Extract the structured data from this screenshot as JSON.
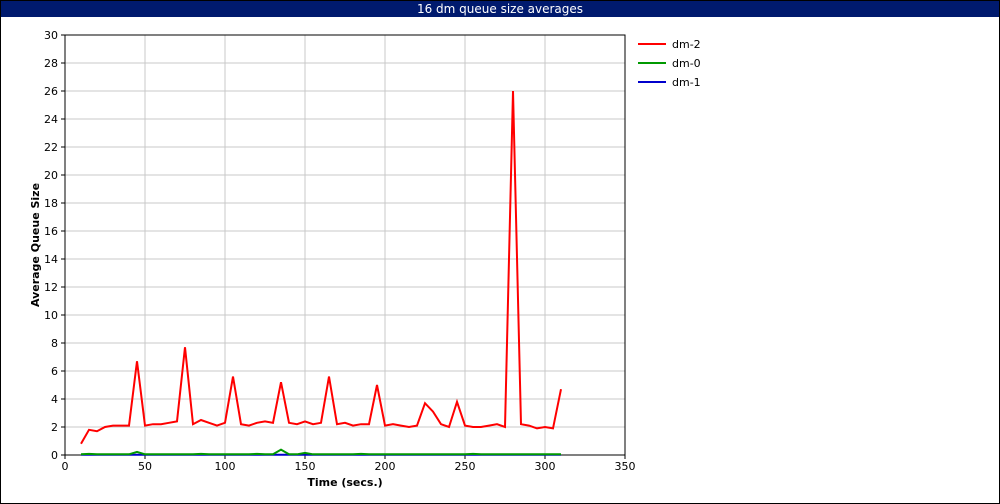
{
  "chart_data": {
    "type": "line",
    "title": "16 dm queue size averages",
    "xlabel": "Time (secs.)",
    "ylabel": "Average Queue Size",
    "xlim": [
      0,
      350
    ],
    "ylim": [
      0,
      30
    ],
    "xticks": [
      0,
      50,
      100,
      150,
      200,
      250,
      300,
      350
    ],
    "yticks": [
      0,
      2,
      4,
      6,
      8,
      10,
      12,
      14,
      16,
      18,
      20,
      22,
      24,
      26,
      28,
      30
    ],
    "grid": true,
    "legend_position": "top-right, outside plot",
    "x": [
      10,
      15,
      20,
      25,
      30,
      35,
      40,
      45,
      50,
      55,
      60,
      65,
      70,
      75,
      80,
      85,
      90,
      95,
      100,
      105,
      110,
      115,
      120,
      125,
      130,
      135,
      140,
      145,
      150,
      155,
      160,
      165,
      170,
      175,
      180,
      185,
      190,
      195,
      200,
      205,
      210,
      215,
      220,
      225,
      230,
      235,
      240,
      245,
      250,
      255,
      260,
      265,
      270,
      275,
      280,
      285,
      290,
      295,
      300,
      305,
      310
    ],
    "series": [
      {
        "name": "dm-2",
        "color": "#ff0000",
        "values": [
          0.8,
          1.8,
          1.7,
          2.0,
          2.1,
          2.1,
          2.1,
          6.7,
          2.1,
          2.2,
          2.2,
          2.3,
          2.4,
          7.7,
          2.2,
          2.5,
          2.3,
          2.1,
          2.3,
          5.6,
          2.2,
          2.1,
          2.3,
          2.4,
          2.3,
          5.2,
          2.3,
          2.2,
          2.4,
          2.2,
          2.3,
          5.6,
          2.2,
          2.3,
          2.1,
          2.2,
          2.2,
          5.0,
          2.1,
          2.2,
          2.1,
          2.0,
          2.1,
          3.7,
          3.1,
          2.2,
          2.0,
          3.8,
          2.1,
          2.0,
          2.0,
          2.1,
          2.2,
          2.0,
          26.0,
          2.2,
          2.1,
          1.9,
          2.0,
          1.9,
          4.7
        ]
      },
      {
        "name": "dm-0",
        "color": "#009900",
        "values": [
          0.05,
          0.08,
          0.05,
          0.05,
          0.05,
          0.05,
          0.05,
          0.22,
          0.05,
          0.05,
          0.05,
          0.05,
          0.05,
          0.05,
          0.05,
          0.08,
          0.05,
          0.05,
          0.05,
          0.05,
          0.05,
          0.05,
          0.08,
          0.05,
          0.05,
          0.38,
          0.05,
          0.05,
          0.15,
          0.05,
          0.05,
          0.05,
          0.05,
          0.05,
          0.05,
          0.08,
          0.05,
          0.05,
          0.05,
          0.05,
          0.05,
          0.05,
          0.05,
          0.05,
          0.05,
          0.05,
          0.05,
          0.05,
          0.05,
          0.08,
          0.05,
          0.05,
          0.05,
          0.05,
          0.05,
          0.05,
          0.05,
          0.05,
          0.05,
          0.05,
          0.05
        ]
      },
      {
        "name": "dm-1",
        "color": "#0000cc",
        "values": [
          0.02,
          0.02,
          0.02,
          0.02,
          0.02,
          0.02,
          0.02,
          0.02,
          0.02,
          0.02,
          0.02,
          0.02,
          0.02,
          0.02,
          0.02,
          0.02,
          0.02,
          0.02,
          0.02,
          0.02,
          0.02,
          0.02,
          0.02,
          0.02,
          0.02,
          0.02,
          0.02,
          0.02,
          0.02,
          0.02,
          0.02,
          0.02,
          0.02,
          0.02,
          0.02,
          0.02,
          0.02,
          0.02,
          0.02,
          0.02,
          0.02,
          0.02,
          0.02,
          0.02,
          0.02,
          0.02,
          0.02,
          0.02,
          0.02,
          0.02,
          0.02,
          0.02,
          0.02,
          0.02,
          0.02,
          0.02,
          0.02,
          0.02,
          0.02,
          0.02,
          0.02
        ]
      }
    ]
  }
}
